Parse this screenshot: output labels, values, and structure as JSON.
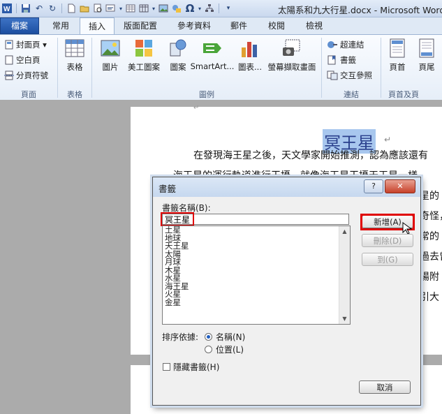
{
  "window": {
    "title": "太陽系和九大行星.docx - Microsoft Word"
  },
  "quick_access": {
    "icons": [
      "word-logo-icon",
      "save-icon",
      "undo-icon",
      "redo-icon",
      "new-doc-icon",
      "open-icon",
      "print-preview-icon",
      "spelling-icon",
      "insert-table-icon",
      "picture-icon",
      "omega-icon",
      "org-chart-icon",
      "customize-icon"
    ]
  },
  "tabs": [
    {
      "label": "檔案"
    },
    {
      "label": "常用"
    },
    {
      "label": "插入"
    },
    {
      "label": "版面配置"
    },
    {
      "label": "參考資料"
    },
    {
      "label": "郵件"
    },
    {
      "label": "校閱"
    },
    {
      "label": "檢視"
    }
  ],
  "ribbon": {
    "pages": {
      "label": "頁面",
      "items": [
        {
          "label": "封面頁 ▾",
          "icon": "cover-page-icon"
        },
        {
          "label": "空白頁",
          "icon": "blank-page-icon"
        },
        {
          "label": "分頁符號",
          "icon": "page-break-icon"
        }
      ]
    },
    "tables": {
      "label": "表格",
      "button": "表格"
    },
    "illustrations": {
      "label": "圖例",
      "buttons": [
        {
          "label": "圖片",
          "icon": "picture-icon"
        },
        {
          "label": "美工圖案",
          "icon": "clip-art-icon"
        },
        {
          "label": "圖案",
          "icon": "shapes-icon"
        },
        {
          "label": "SmartArt...",
          "icon": "smartart-icon"
        },
        {
          "label": "圖表...",
          "icon": "chart-icon"
        },
        {
          "label": "螢幕擷取畫面",
          "icon": "screenshot-icon"
        }
      ]
    },
    "links": {
      "label": "連結",
      "items": [
        {
          "label": "超連結",
          "icon": "hyperlink-icon"
        },
        {
          "label": "書籤",
          "icon": "bookmark-icon"
        },
        {
          "label": "交互參照",
          "icon": "cross-reference-icon"
        }
      ]
    },
    "header_footer": {
      "label": "頁首及頁",
      "buttons": [
        {
          "label": "頁首",
          "icon": "header-icon"
        },
        {
          "label": "頁尾",
          "icon": "footer-icon"
        }
      ]
    }
  },
  "document": {
    "heading": "冥王星",
    "lines": [
      "在發現海王星之後，天文學家開始推測，認為應該還有",
      "海王星的運行軌道進行干擾，就像海王星干擾天王星一樣，",
      "星的",
      "奇怪，較",
      "常的",
      "過去曾",
      "陽附",
      "引大"
    ]
  },
  "dialog": {
    "title": "書籤",
    "help_label": "?",
    "close_label": "✕",
    "name_label": "書籤名稱(B):",
    "name_value": "冥王星",
    "bookmarks": [
      "土星",
      "地球",
      "天王星",
      "太陽",
      "月球",
      "木星",
      "水星",
      "海王星",
      "火星",
      "金星"
    ],
    "buttons": {
      "add": "新增(A)",
      "delete": "刪除(D)",
      "goto": "到(G)",
      "cancel": "取消"
    },
    "sort_label": "排序依據:",
    "sort_options": [
      {
        "label": "名稱(N)",
        "selected": true
      },
      {
        "label": "位置(L)",
        "selected": false
      }
    ],
    "hidden_label": "隱藏書籤(H)",
    "hidden_checked": false
  },
  "colors": {
    "file_tab": "#2a5db0",
    "highlight": "#e00000",
    "selection": "#a8c7ee"
  }
}
